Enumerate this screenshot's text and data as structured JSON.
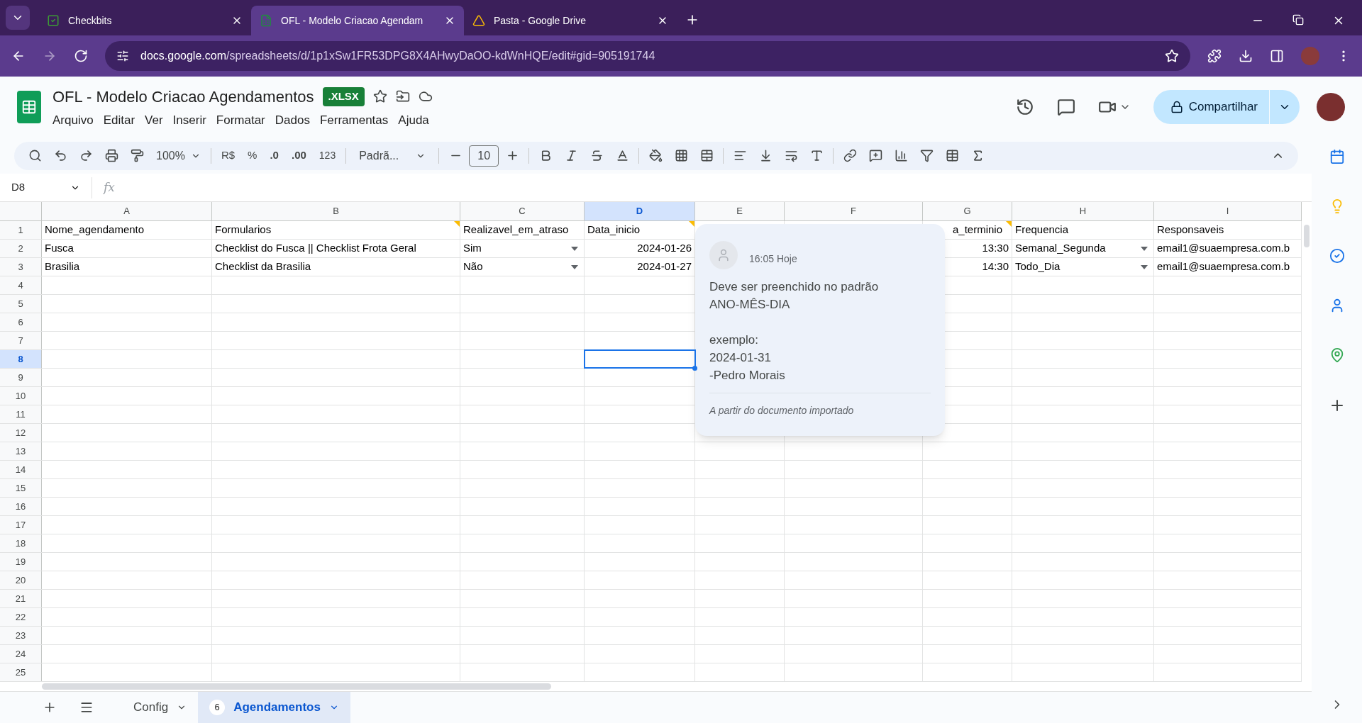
{
  "browser": {
    "tabs": [
      {
        "title": "Checkbits",
        "selected": false
      },
      {
        "title": "OFL - Modelo Criacao Agendam",
        "selected": true
      },
      {
        "title": "Pasta - Google Drive",
        "selected": false
      }
    ],
    "url_host": "docs.google.com",
    "url_path": "/spreadsheets/d/1p1xSw1FR53DPG8X4AHwyDaOO-kdWnHQE/edit#gid=905191744"
  },
  "document": {
    "title": "OFL - Modelo Criacao Agendamentos",
    "badge": ".XLSX",
    "share": "Compartilhar"
  },
  "menu": [
    "Arquivo",
    "Editar",
    "Ver",
    "Inserir",
    "Formatar",
    "Dados",
    "Ferramentas",
    "Ajuda"
  ],
  "toolbar": {
    "zoom": "100%",
    "currency": "R$",
    "percent": "%",
    "decrease_decimals": ".0",
    "increase_decimals": ".00",
    "number_format": "123",
    "font": "Padrã...",
    "font_size": "10"
  },
  "name_box": "D8",
  "formula_label": "fx",
  "columns": [
    {
      "letter": "A",
      "selected": false
    },
    {
      "letter": "B",
      "selected": false
    },
    {
      "letter": "C",
      "selected": false
    },
    {
      "letter": "D",
      "selected": true
    },
    {
      "letter": "E",
      "selected": false
    },
    {
      "letter": "F",
      "selected": false
    },
    {
      "letter": "G",
      "selected": false
    },
    {
      "letter": "H",
      "selected": false
    },
    {
      "letter": "I",
      "selected": false
    }
  ],
  "rows": [
    {
      "number": "1",
      "selected": false,
      "cells": [
        {
          "text": "Nome_agendamento",
          "kind": "text",
          "note": false
        },
        {
          "text": "Formularios",
          "kind": "text",
          "note": true
        },
        {
          "text": "Realizavel_em_atraso",
          "kind": "text",
          "note": false
        },
        {
          "text": "Data_inicio",
          "kind": "text",
          "note": true
        },
        null,
        null,
        {
          "text": "a_terminio",
          "kind": "text",
          "note": true
        },
        {
          "text": "Frequencia",
          "kind": "text",
          "note": false
        },
        {
          "text": "Responsaveis",
          "kind": "text",
          "note": false
        }
      ]
    },
    {
      "number": "2",
      "selected": false,
      "cells": [
        {
          "text": "Fusca",
          "kind": "text",
          "note": false
        },
        {
          "text": "Checklist do Fusca || Checklist Frota Geral",
          "kind": "text",
          "note": false
        },
        {
          "text": "Sim",
          "kind": "dropdown",
          "note": false
        },
        {
          "text": "2024-01-26",
          "kind": "number",
          "note": false
        },
        null,
        null,
        {
          "text": "13:30",
          "kind": "number",
          "note": false
        },
        {
          "text": "Semanal_Segunda",
          "kind": "dropdown",
          "note": false
        },
        {
          "text": "email1@suaempresa.com.b",
          "kind": "text",
          "note": false
        }
      ]
    },
    {
      "number": "3",
      "selected": false,
      "cells": [
        {
          "text": "Brasilia",
          "kind": "text",
          "note": false
        },
        {
          "text": "Checklist da Brasilia",
          "kind": "text",
          "note": false
        },
        {
          "text": "Não",
          "kind": "dropdown",
          "note": false
        },
        {
          "text": "2024-01-27",
          "kind": "number",
          "note": false
        },
        null,
        null,
        {
          "text": "14:30",
          "kind": "number",
          "note": false
        },
        {
          "text": "Todo_Dia",
          "kind": "dropdown",
          "note": false
        },
        {
          "text": "email1@suaempresa.com.b",
          "kind": "text",
          "note": false
        }
      ]
    },
    {
      "number": "4",
      "selected": false
    },
    {
      "number": "5",
      "selected": false
    },
    {
      "number": "6",
      "selected": false
    },
    {
      "number": "7",
      "selected": false
    },
    {
      "number": "8",
      "selected": true
    },
    {
      "number": "9",
      "selected": false
    },
    {
      "number": "10",
      "selected": false
    },
    {
      "number": "11",
      "selected": false
    },
    {
      "number": "12",
      "selected": false
    },
    {
      "number": "13",
      "selected": false
    },
    {
      "number": "14",
      "selected": false
    },
    {
      "number": "15",
      "selected": false
    },
    {
      "number": "16",
      "selected": false
    },
    {
      "number": "17",
      "selected": false
    },
    {
      "number": "18",
      "selected": false
    },
    {
      "number": "19",
      "selected": false
    },
    {
      "number": "20",
      "selected": false
    },
    {
      "number": "21",
      "selected": false
    },
    {
      "number": "22",
      "selected": false
    },
    {
      "number": "23",
      "selected": false
    },
    {
      "number": "24",
      "selected": false
    },
    {
      "number": "25",
      "selected": false
    }
  ],
  "comment": {
    "time": "16:05 Hoje",
    "body": "Deve ser preenchido no padrão\nANO-MÊS-DIA\n\nexemplo:\n2024-01-31\n-Pedro Morais",
    "footer": "A partir do documento importado"
  },
  "sheets": [
    {
      "name": "Config",
      "selected": false
    },
    {
      "name": "Agendamentos",
      "badge": "6",
      "selected": true
    }
  ]
}
